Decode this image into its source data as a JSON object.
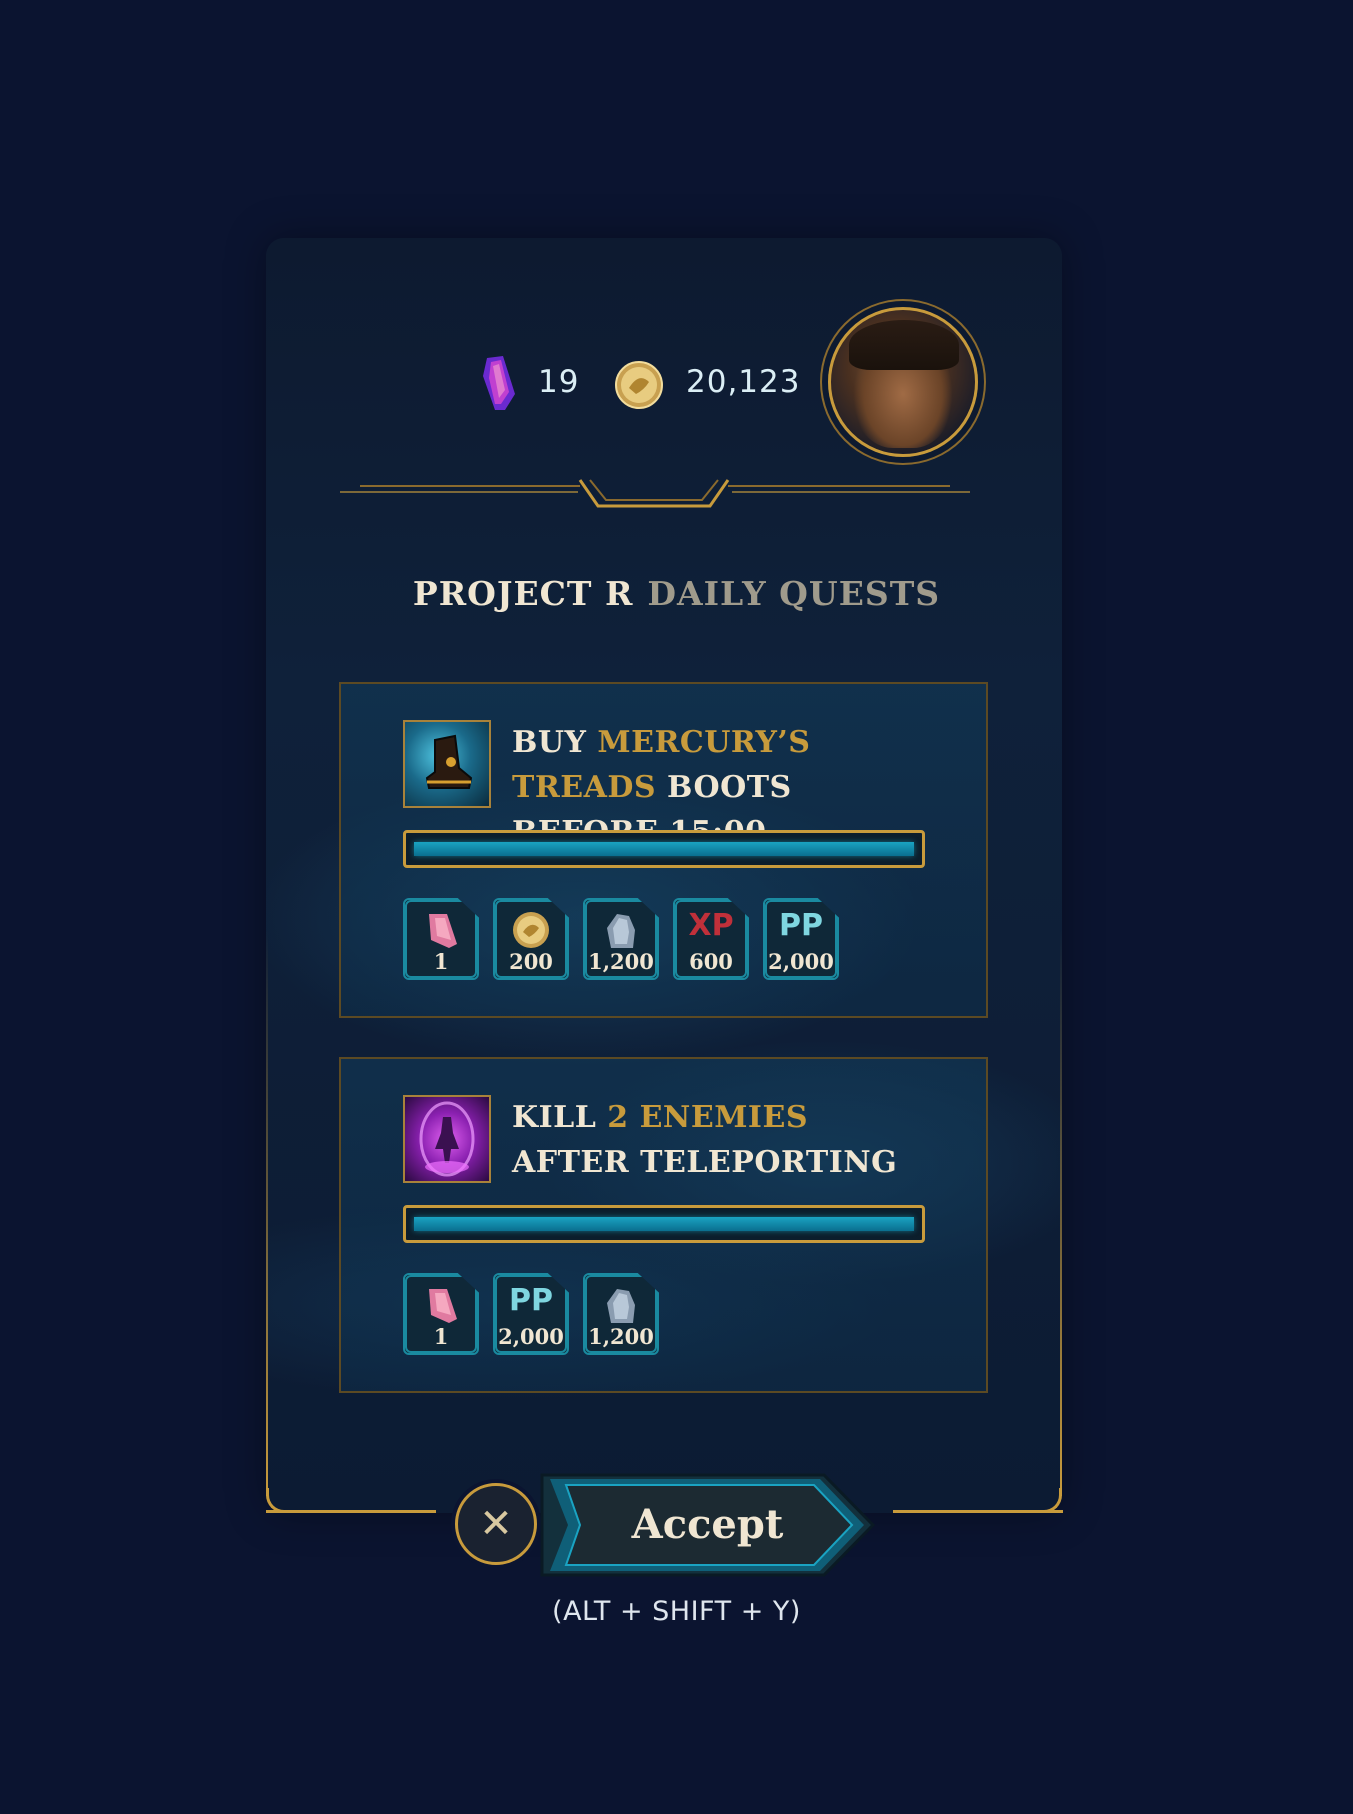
{
  "currency": {
    "gems": "19",
    "coins": "20,123"
  },
  "title": {
    "part1": "PROJECT R",
    "part2": "DAILY QUESTS"
  },
  "quests": [
    {
      "text_pre": "BUY ",
      "text_highlight": "MERCURY’S TREADS",
      "text_post": " BOOTS BEFORE 15:00",
      "icon": "boots-icon",
      "progress": 1.0,
      "rewards": [
        {
          "type": "gem",
          "value": "1"
        },
        {
          "type": "coin",
          "value": "200"
        },
        {
          "type": "ore",
          "value": "1,200"
        },
        {
          "type": "xp",
          "label": "XP",
          "value": "600"
        },
        {
          "type": "pp",
          "label": "PP",
          "value": "2,000"
        }
      ]
    },
    {
      "text_pre": "KILL ",
      "text_highlight": "2 ENEMIES",
      "text_post": " AFTER TELEPORTING",
      "icon": "teleport-icon",
      "progress": 1.0,
      "rewards": [
        {
          "type": "gem",
          "value": "1"
        },
        {
          "type": "pp",
          "label": "PP",
          "value": "2,000"
        },
        {
          "type": "ore",
          "value": "1,200"
        }
      ]
    }
  ],
  "buttons": {
    "close": "✕",
    "accept": "Accept"
  },
  "shortcut": "(ALT + SHIFT + Y)",
  "colors": {
    "gold": "#c89b3c",
    "background": "#0b1430",
    "progress": "#1aa3c2",
    "xp": "#c0303a",
    "pp": "#7fd6e0"
  }
}
